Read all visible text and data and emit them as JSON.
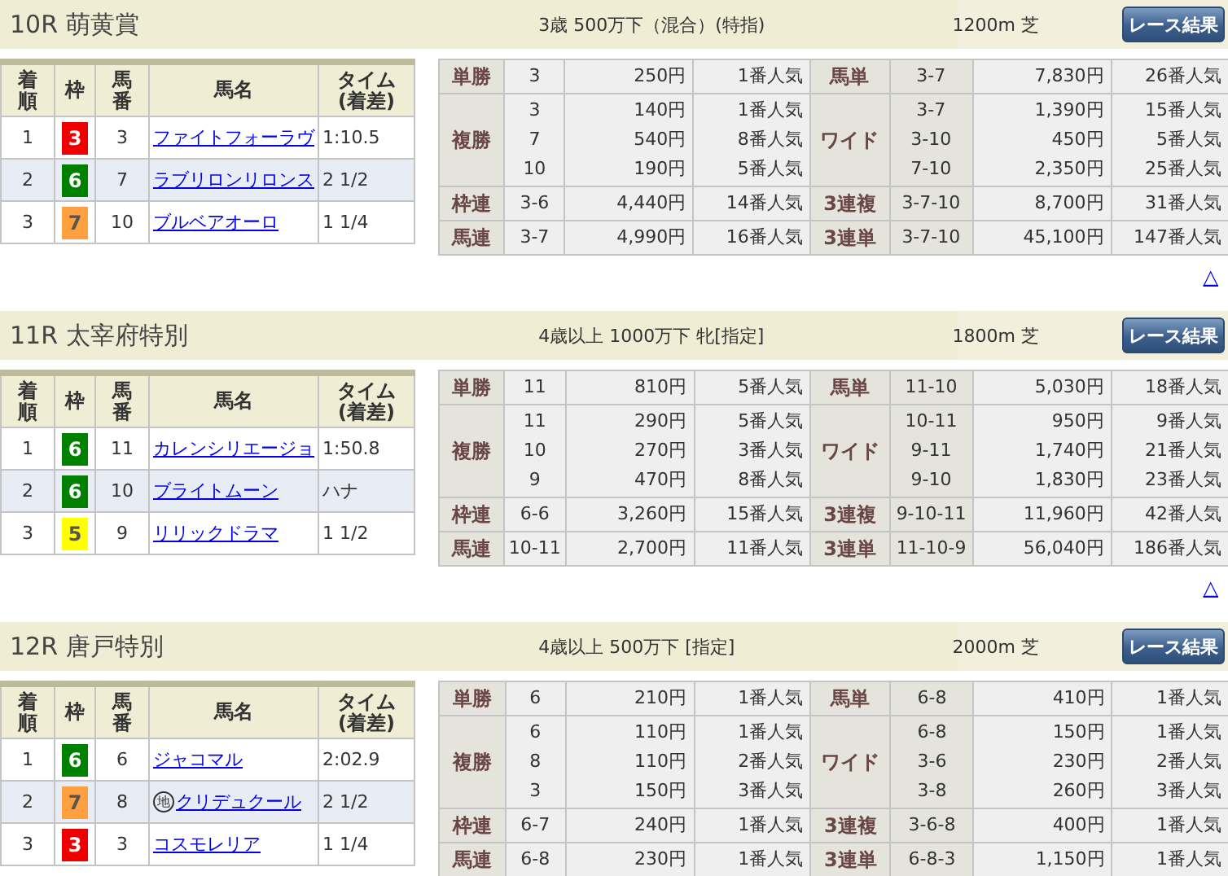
{
  "races": [
    {
      "title": "10R 萌黄賞",
      "conditions": "3歳 500万下（混合）(特指)",
      "course": "1200m 芝",
      "result_button": "レース結果",
      "columns": [
        "着順",
        "枠",
        "馬番",
        "馬名",
        "タイム(着差)"
      ],
      "results": [
        {
          "finish": "1",
          "frame": "3",
          "color": "#ee0000",
          "number": "3",
          "horse": "ファイトフォーラヴ",
          "time": "1:10.5"
        },
        {
          "finish": "2",
          "frame": "6",
          "color": "#008000",
          "number": "7",
          "horse": "ラブリロンリロンス",
          "time": "2 1/2"
        },
        {
          "finish": "3",
          "frame": "7",
          "color": "#ffa040",
          "number": "10",
          "horse": "ブルベアオーロ",
          "time": "1 1/4"
        }
      ],
      "payouts": [
        {
          "left": {
            "type": "単勝",
            "entries": [
              {
                "combo": "3",
                "payout": "250円",
                "popularity": "1番人気"
              }
            ]
          },
          "right": {
            "type": "馬単",
            "entries": [
              {
                "combo": "3-7",
                "payout": "7,830円",
                "popularity": "26番人気"
              }
            ]
          }
        },
        {
          "left": {
            "type": "複勝",
            "entries": [
              {
                "combo": "3",
                "payout": "140円",
                "popularity": "1番人気"
              },
              {
                "combo": "7",
                "payout": "540円",
                "popularity": "8番人気"
              },
              {
                "combo": "10",
                "payout": "190円",
                "popularity": "5番人気"
              }
            ]
          },
          "right": {
            "type": "ワイド",
            "entries": [
              {
                "combo": "3-7",
                "payout": "1,390円",
                "popularity": "15番人気"
              },
              {
                "combo": "3-10",
                "payout": "450円",
                "popularity": "5番人気"
              },
              {
                "combo": "7-10",
                "payout": "2,350円",
                "popularity": "25番人気"
              }
            ]
          }
        },
        {
          "left": {
            "type": "枠連",
            "entries": [
              {
                "combo": "3-6",
                "payout": "4,440円",
                "popularity": "14番人気"
              }
            ]
          },
          "right": {
            "type": "3連複",
            "entries": [
              {
                "combo": "3-7-10",
                "payout": "8,700円",
                "popularity": "31番人気"
              }
            ]
          }
        },
        {
          "left": {
            "type": "馬連",
            "entries": [
              {
                "combo": "3-7",
                "payout": "4,990円",
                "popularity": "16番人気"
              }
            ]
          },
          "right": {
            "type": "3連単",
            "entries": [
              {
                "combo": "3-7-10",
                "payout": "45,100円",
                "popularity": "147番人気"
              }
            ]
          }
        }
      ],
      "to_top": "△"
    },
    {
      "title": "11R 太宰府特別",
      "conditions": "4歳以上 1000万下 牝[指定]",
      "course": "1800m 芝",
      "result_button": "レース結果",
      "columns": [
        "着順",
        "枠",
        "馬番",
        "馬名",
        "タイム(着差)"
      ],
      "results": [
        {
          "finish": "1",
          "frame": "6",
          "color": "#008000",
          "number": "11",
          "horse": "カレンシリエージョ",
          "time": "1:50.8"
        },
        {
          "finish": "2",
          "frame": "6",
          "color": "#008000",
          "number": "10",
          "horse": "ブライトムーン",
          "time": "ハナ"
        },
        {
          "finish": "3",
          "frame": "5",
          "color": "#ffff00",
          "number": "9",
          "horse": "リリックドラマ",
          "time": "1 1/2"
        }
      ],
      "payouts": [
        {
          "left": {
            "type": "単勝",
            "entries": [
              {
                "combo": "11",
                "payout": "810円",
                "popularity": "5番人気"
              }
            ]
          },
          "right": {
            "type": "馬単",
            "entries": [
              {
                "combo": "11-10",
                "payout": "5,030円",
                "popularity": "18番人気"
              }
            ]
          }
        },
        {
          "left": {
            "type": "複勝",
            "entries": [
              {
                "combo": "11",
                "payout": "290円",
                "popularity": "5番人気"
              },
              {
                "combo": "10",
                "payout": "270円",
                "popularity": "3番人気"
              },
              {
                "combo": "9",
                "payout": "470円",
                "popularity": "8番人気"
              }
            ]
          },
          "right": {
            "type": "ワイド",
            "entries": [
              {
                "combo": "10-11",
                "payout": "950円",
                "popularity": "9番人気"
              },
              {
                "combo": "9-11",
                "payout": "1,740円",
                "popularity": "21番人気"
              },
              {
                "combo": "9-10",
                "payout": "1,830円",
                "popularity": "23番人気"
              }
            ]
          }
        },
        {
          "left": {
            "type": "枠連",
            "entries": [
              {
                "combo": "6-6",
                "payout": "3,260円",
                "popularity": "15番人気"
              }
            ]
          },
          "right": {
            "type": "3連複",
            "entries": [
              {
                "combo": "9-10-11",
                "payout": "11,960円",
                "popularity": "42番人気"
              }
            ]
          }
        },
        {
          "left": {
            "type": "馬連",
            "entries": [
              {
                "combo": "10-11",
                "payout": "2,700円",
                "popularity": "11番人気"
              }
            ]
          },
          "right": {
            "type": "3連単",
            "entries": [
              {
                "combo": "11-10-9",
                "payout": "56,040円",
                "popularity": "186番人気"
              }
            ]
          }
        }
      ],
      "to_top": "△"
    },
    {
      "title": "12R 唐戸特別",
      "conditions": "4歳以上 500万下 [指定]",
      "course": "2000m 芝",
      "result_button": "レース結果",
      "columns": [
        "着順",
        "枠",
        "馬番",
        "馬名",
        "タイム(着差)"
      ],
      "results": [
        {
          "finish": "1",
          "frame": "6",
          "color": "#008000",
          "number": "6",
          "horse": "ジャコマル",
          "time": "2:02.9"
        },
        {
          "finish": "2",
          "frame": "7",
          "color": "#ffa040",
          "number": "8",
          "marker": "地",
          "horse": "クリデュクール",
          "time": "2 1/2"
        },
        {
          "finish": "3",
          "frame": "3",
          "color": "#ee0000",
          "number": "3",
          "horse": "コスモレリア",
          "time": "1 1/4"
        }
      ],
      "payouts": [
        {
          "left": {
            "type": "単勝",
            "entries": [
              {
                "combo": "6",
                "payout": "210円",
                "popularity": "1番人気"
              }
            ]
          },
          "right": {
            "type": "馬単",
            "entries": [
              {
                "combo": "6-8",
                "payout": "410円",
                "popularity": "1番人気"
              }
            ]
          }
        },
        {
          "left": {
            "type": "複勝",
            "entries": [
              {
                "combo": "6",
                "payout": "110円",
                "popularity": "1番人気"
              },
              {
                "combo": "8",
                "payout": "110円",
                "popularity": "2番人気"
              },
              {
                "combo": "3",
                "payout": "150円",
                "popularity": "3番人気"
              }
            ]
          },
          "right": {
            "type": "ワイド",
            "entries": [
              {
                "combo": "6-8",
                "payout": "150円",
                "popularity": "1番人気"
              },
              {
                "combo": "3-6",
                "payout": "230円",
                "popularity": "2番人気"
              },
              {
                "combo": "3-8",
                "payout": "260円",
                "popularity": "3番人気"
              }
            ]
          }
        },
        {
          "left": {
            "type": "枠連",
            "entries": [
              {
                "combo": "6-7",
                "payout": "240円",
                "popularity": "1番人気"
              }
            ]
          },
          "right": {
            "type": "3連複",
            "entries": [
              {
                "combo": "3-6-8",
                "payout": "400円",
                "popularity": "1番人気"
              }
            ]
          }
        },
        {
          "left": {
            "type": "馬連",
            "entries": [
              {
                "combo": "6-8",
                "payout": "230円",
                "popularity": "1番人気"
              }
            ]
          },
          "right": {
            "type": "3連単",
            "entries": [
              {
                "combo": "6-8-3",
                "payout": "1,150円",
                "popularity": "1番人気"
              }
            ]
          }
        }
      ]
    }
  ]
}
